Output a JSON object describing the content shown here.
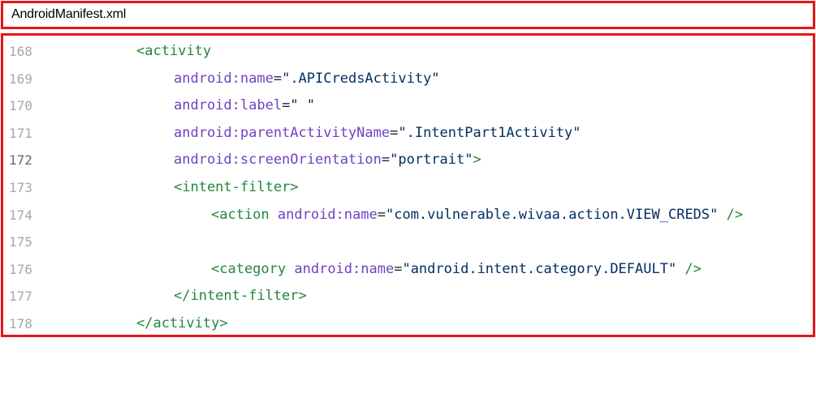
{
  "file": {
    "name": "AndroidManifest.xml"
  },
  "colors": {
    "highlight_border": "#e8151b",
    "tag": "#22863a",
    "attribute": "#6f42c1",
    "string": "#032f62",
    "line_number": "#a8a8a8"
  },
  "lines": [
    {
      "num": "168",
      "p1": "<activity"
    },
    {
      "num": "169",
      "attr": "android:name",
      "eq": "=",
      "val": "\".APICredsActivity\""
    },
    {
      "num": "170",
      "attr": "android:label",
      "eq": "=",
      "val": "\" \""
    },
    {
      "num": "171",
      "attr": "android:parentActivityName",
      "eq": "=",
      "val": "\".IntentPart1Activity\""
    },
    {
      "num": "172",
      "attr": "android:screenOrientation",
      "eq": "=",
      "val": "\"portrait\"",
      "end": ">"
    },
    {
      "num": "173",
      "p1": "<intent-filter>"
    },
    {
      "num": "174",
      "p1": "<action",
      "attr": "android:name",
      "eq": "=",
      "val": "\"com.vulnerable.wivaa.action.VIEW_CREDS\"",
      "end": " />"
    },
    {
      "num": "175"
    },
    {
      "num": "176",
      "p1": "<category",
      "attr": "android:name",
      "eq": "=",
      "val": "\"android.intent.category.DEFAULT\"",
      "end": " />"
    },
    {
      "num": "177",
      "p1": "</intent-filter>"
    },
    {
      "num": "178",
      "p1": "</activity>"
    }
  ]
}
